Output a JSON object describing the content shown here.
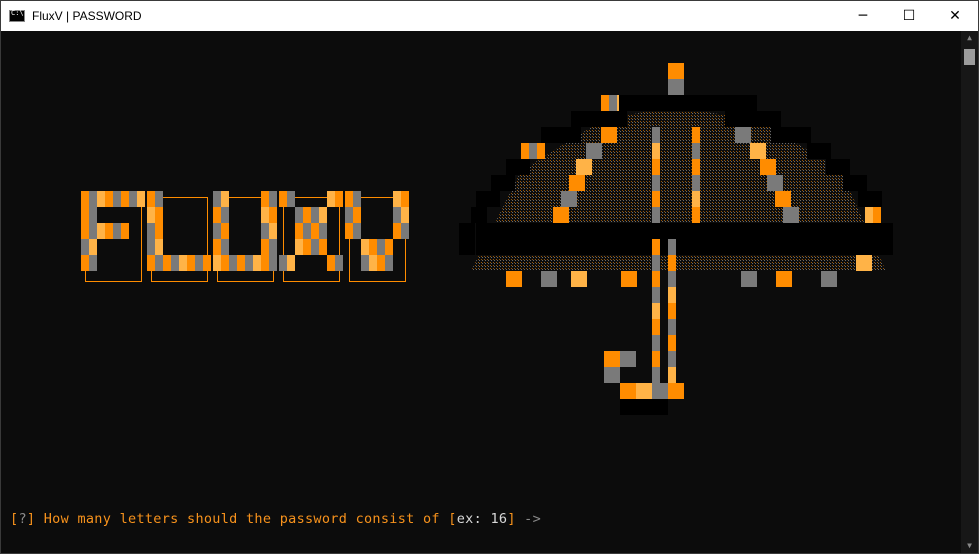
{
  "window": {
    "title": "FluxV | PASSWORD",
    "icon": "console-icon",
    "controls": {
      "minimize": "─",
      "maximize": "☐",
      "close": "✕"
    }
  },
  "banner": {
    "logo_text": "FLUXV",
    "graphic": "umbrella-ascii-art",
    "colors": {
      "primary": "#ff8c00",
      "secondary": "#7a7a7a",
      "accent": "#ffb347"
    }
  },
  "prompt": {
    "open_bracket": "[",
    "marker": "?",
    "close_bracket": "]",
    "question": " How many letters should the password consist of ",
    "example_open": "[",
    "example_label": "ex:",
    "example_value": " 16",
    "example_close": "]",
    "arrow": " ->"
  }
}
